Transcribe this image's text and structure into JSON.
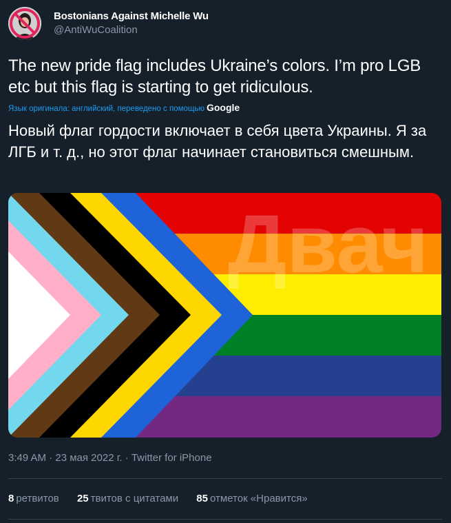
{
  "author": {
    "display_name": "Bostonians Against Michelle Wu",
    "handle": "@AntiWuCoalition",
    "avatar_icon": "prohibited-sign-avatar-icon"
  },
  "tweet": {
    "text": "The new pride flag includes Ukraine’s colors. I’m pro LGB etc but this flag is starting to get ridiculous.",
    "translation_note": "Язык оригинала: английский, переведено с помощью",
    "translation_provider": "Google",
    "translated_text": "Новый флаг гордости включает в себя цвета Украины. Я за ЛГБ и т. д., но этот флаг начинает становиться смешным.",
    "image_watermark": "Двач"
  },
  "meta": {
    "text": "3:49 AM · 23 мая 2022 г. · Twitter for iPhone"
  },
  "stats": {
    "retweets_count": "8",
    "retweets_label": "ретвитов",
    "quotes_count": "25",
    "quotes_label": "твитов с цитатами",
    "likes_count": "85",
    "likes_label": "отметок «Нравится»"
  },
  "colors": {
    "background": "#15202b",
    "link": "#1d9bf0",
    "secondary_text": "#8b98a5",
    "flag_red": "#e40303",
    "flag_orange": "#ff8c00",
    "flag_yellow": "#ffed00",
    "flag_green": "#008026",
    "flag_blue": "#24408e",
    "flag_purple": "#732982",
    "chevron_blue": "#1e63d8",
    "chevron_yellow": "#ffd700",
    "chevron_black": "#000000",
    "chevron_brown": "#613915",
    "chevron_light_blue": "#73d7ee",
    "chevron_pink": "#ffafc8",
    "chevron_white": "#ffffff"
  }
}
